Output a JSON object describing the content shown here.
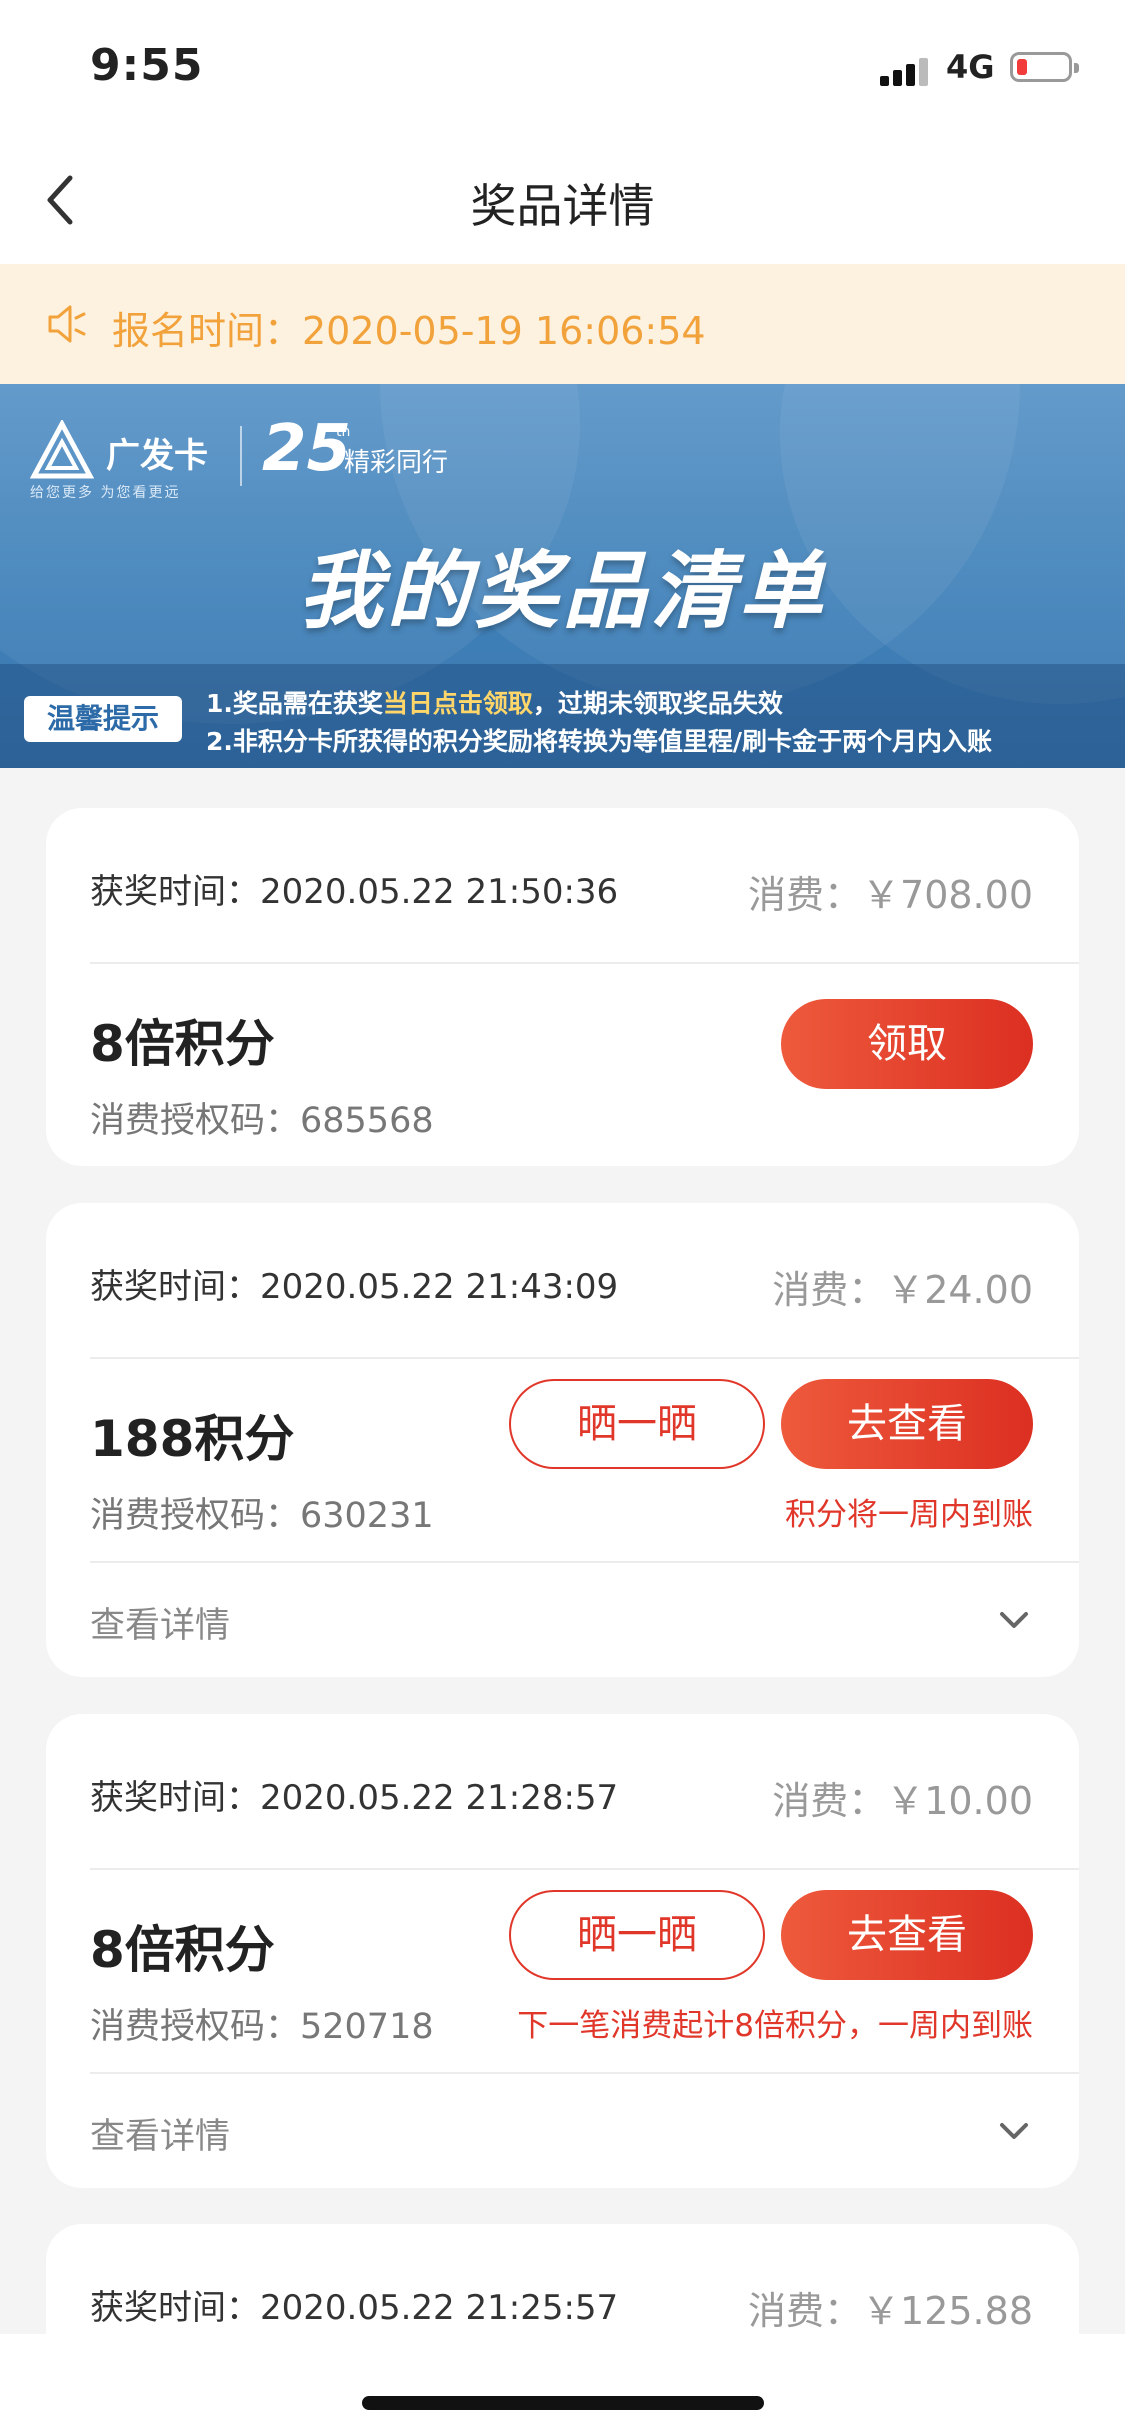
{
  "status_bar": {
    "time": "9:55",
    "network": "4G"
  },
  "nav": {
    "title": "奖品详情"
  },
  "notice": {
    "text": "报名时间：2020-05-19 16:06:54"
  },
  "banner": {
    "brand": "广发卡",
    "slogan": "给您更多 为您看更远",
    "anniversary_number": "25",
    "anniversary_suffix": "th",
    "anniversary_text": "精彩同行",
    "title": "我的奖品清单",
    "tips_tag": "温馨提示",
    "tip1_prefix": "1.奖品需在获奖",
    "tip1_highlight": "当日点击领取",
    "tip1_suffix": "，过期未领取奖品失效",
    "tip2": "2.非积分卡所获得的积分奖励将转换为等值里程/刷卡金于两个月内入账"
  },
  "cards": [
    {
      "award_time": "获奖时间：2020.05.22 21:50:36",
      "amount": "消费：￥708.00",
      "prize": "8倍积分",
      "auth_code": "消费授权码：685568",
      "primary_button": "领取"
    },
    {
      "award_time": "获奖时间：2020.05.22 21:43:09",
      "amount": "消费：￥24.00",
      "prize": "188积分",
      "auth_code": "消费授权码：630231",
      "share_button": "晒一晒",
      "primary_button": "去查看",
      "note": "积分将一周内到账",
      "details": "查看详情"
    },
    {
      "award_time": "获奖时间：2020.05.22 21:28:57",
      "amount": "消费：￥10.00",
      "prize": "8倍积分",
      "auth_code": "消费授权码：520718",
      "share_button": "晒一晒",
      "primary_button": "去查看",
      "note": "下一笔消费起计8倍积分，一周内到账",
      "details": "查看详情"
    },
    {
      "award_time": "获奖时间：2020.05.22 21:25:57",
      "amount": "消费：￥125.88"
    }
  ],
  "colors": {
    "accent_red": "#e0372a",
    "notice_orange": "#f2a23a",
    "banner_blue": "#3f80b8"
  }
}
